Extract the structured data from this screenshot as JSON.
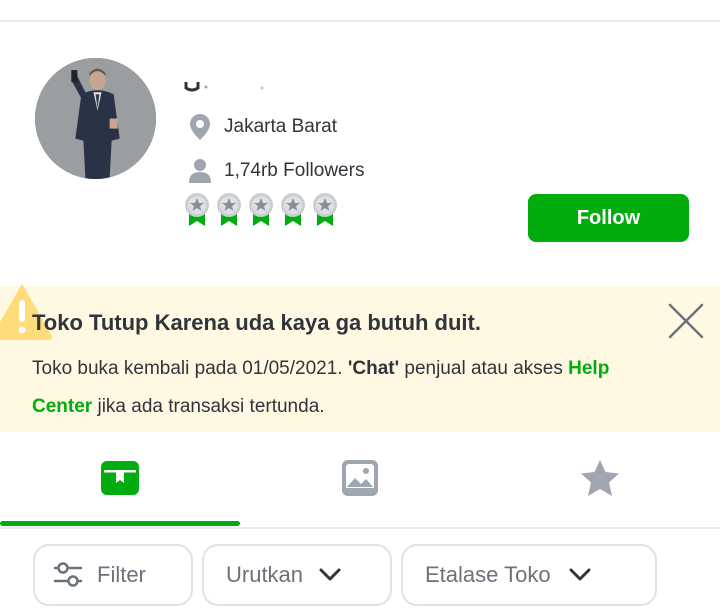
{
  "shop": {
    "location": "Jakarta Barat",
    "followers": "1,74rb Followers",
    "badge_icon": "silver-medal-badge",
    "follow_label": "Follow"
  },
  "notice": {
    "title": "Toko Tutup Karena uda kaya ga butuh duit.",
    "desc_part1": "Toko buka kembali pada 01/05/2021. ",
    "chat_label": "'Chat'",
    "desc_part2": " penjual atau akses ",
    "help_center_label": "Help Center",
    "desc_part3": " jika ada transaksi tertunda.",
    "background_color": "#fff9e3",
    "warning_color": "#ffd45f"
  },
  "tabs": [
    {
      "icon": "product-box-icon",
      "active": true
    },
    {
      "icon": "image-feed-icon",
      "active": false
    },
    {
      "icon": "star-review-icon",
      "active": false
    }
  ],
  "filters": {
    "filter_label": "Filter",
    "sort_label": "Urutkan",
    "showcase_label": "Etalase Toko"
  },
  "colors": {
    "accent": "#03ac0e",
    "text_primary": "#31353b",
    "text_secondary": "#6c727c",
    "icon_gray": "#9fa6b0"
  }
}
